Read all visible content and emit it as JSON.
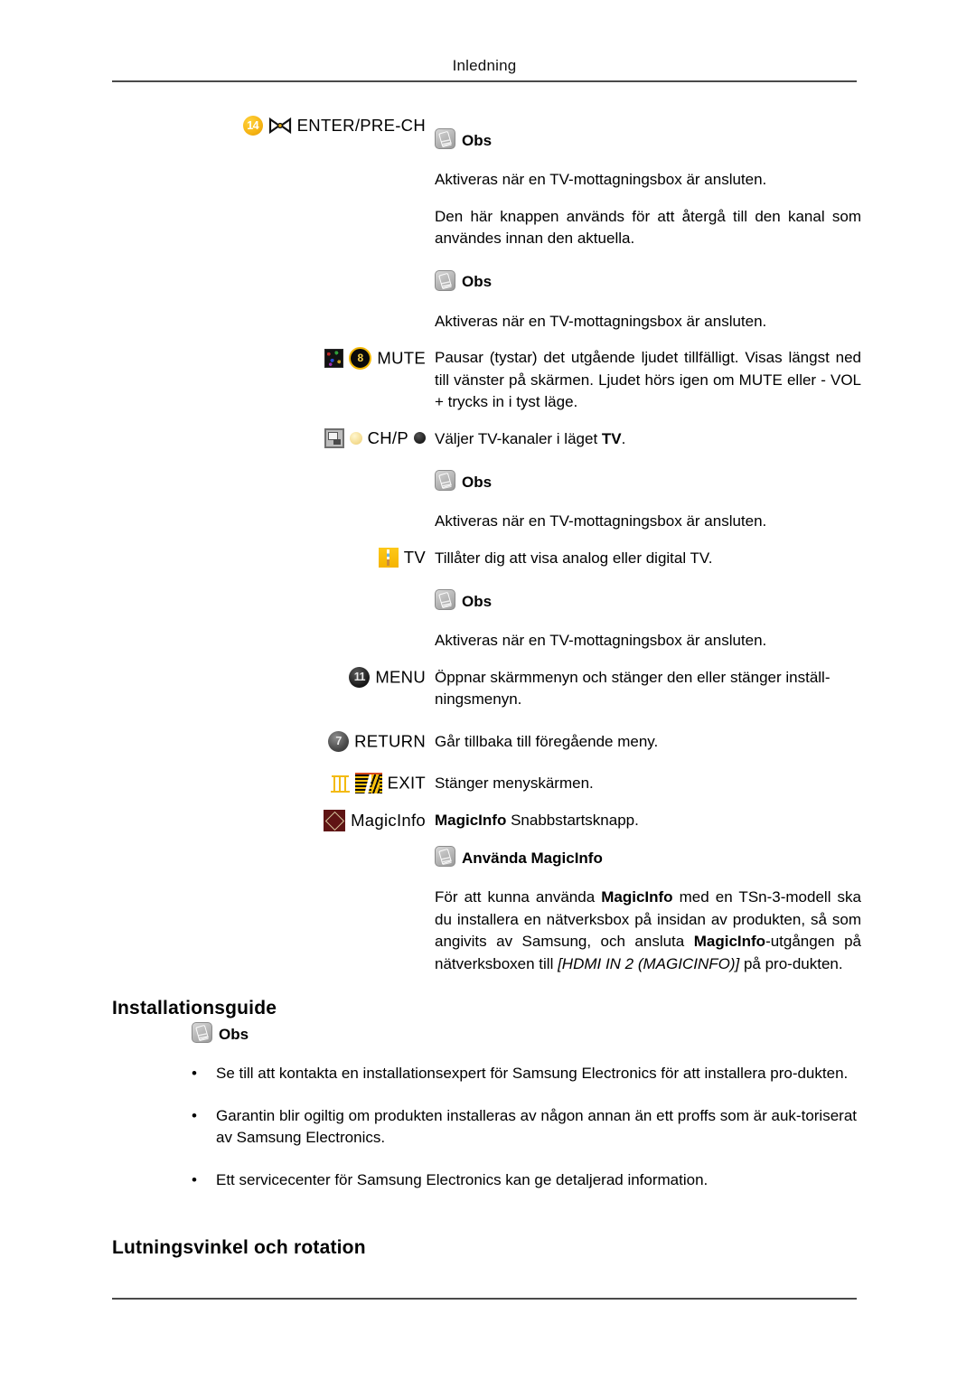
{
  "page": {
    "running_head": "Inledning"
  },
  "button_table": [
    {
      "id": "enter-pre-ch",
      "badge": "14",
      "label": "ENTER/PRE-CH",
      "blocks": [
        {
          "type": "note",
          "text": "Obs"
        },
        {
          "type": "para",
          "text": "Aktiveras när en TV-mottagningsbox är ansluten."
        },
        {
          "type": "para",
          "text": "Den här knappen används för att återgå till den kanal som användes innan den aktuella."
        },
        {
          "type": "note",
          "text": "Obs"
        },
        {
          "type": "para",
          "text": "Aktiveras när en TV-mottagningsbox är ansluten."
        }
      ]
    },
    {
      "id": "mute",
      "badge": "8",
      "label": "MUTE",
      "blocks": [
        {
          "type": "para",
          "text": "Pausar (tystar) det utgående ljudet tillfälligt. Visas längst ned till vänster på skärmen. Ljudet hörs igen om MUTE eller - VOL + trycks in i tyst läge."
        }
      ]
    },
    {
      "id": "ch-p",
      "label": "CH/P",
      "blocks": [
        {
          "type": "para",
          "text": "Väljer TV-kanaler i läget TV."
        },
        {
          "type": "note",
          "text": "Obs"
        },
        {
          "type": "para",
          "text": "Aktiveras när en TV-mottagningsbox är ansluten."
        }
      ]
    },
    {
      "id": "tv",
      "label": "TV",
      "blocks": [
        {
          "type": "para",
          "text": "Tillåter dig att visa analog eller digital TV."
        },
        {
          "type": "note",
          "text": "Obs"
        },
        {
          "type": "para",
          "text": "Aktiveras när en TV-mottagningsbox är ansluten."
        }
      ]
    },
    {
      "id": "menu",
      "badge": "11",
      "label": "MENU",
      "blocks": [
        {
          "type": "para",
          "text": "Öppnar skärmmenyn och stänger den eller stänger inställ-ningsmenyn."
        }
      ]
    },
    {
      "id": "return",
      "badge": "7",
      "label": "RETURN",
      "blocks": [
        {
          "type": "para",
          "text": "Går tillbaka till föregående meny."
        }
      ]
    },
    {
      "id": "exit",
      "label": "EXIT",
      "blocks": [
        {
          "type": "para",
          "text": "Stänger menyskärmen."
        }
      ]
    },
    {
      "id": "magicinfo",
      "label": "MagicInfo",
      "blocks": [
        {
          "type": "para_rich",
          "text": "MagicInfo Snabbstartsknapp."
        },
        {
          "type": "note",
          "text": "Använda MagicInfo"
        },
        {
          "type": "para_rich",
          "text": "För att kunna använda MagicInfo med en TSn-3-modell ska du installera en nätverksbox på insidan av produkten, så som angivits av Samsung, och ansluta MagicInfo-utgången på nätverksboxen till [HDMI IN 2 (MAGICINFO)] på pro-dukten."
        }
      ]
    }
  ],
  "rich": {
    "magicinfo_shortcut": {
      "bold_lead": "MagicInfo",
      "rest": " Snabbstartsknapp."
    },
    "magicinfo_para": {
      "s1": "För att kunna använda ",
      "b1": "MagicInfo",
      "s2": " med en TSn-3-modell ska du installera en nätverksbox på insidan av produkten, så som angivits av Samsung, och ansluta ",
      "b2": "MagicInfo",
      "s3": "-utgången på nätverksboxen till ",
      "i1": "[HDMI IN 2 (MAGICINFO)]",
      "s4": " på pro-dukten."
    },
    "mute_para": {
      "s1": "Pausar (tystar) det utgående ljudet tillfälligt. Visas längst ned till vänster på skärmen. Ljudet hörs igen om MUTE eller - VOL + trycks in i tyst läge."
    },
    "chp_para": {
      "s1": "Väljer TV-kanaler i läget ",
      "b1": "TV",
      "s2": "."
    }
  },
  "installation": {
    "heading": "Installationsguide",
    "note": "Obs",
    "bullet_marker": "•",
    "bullets": [
      "Se till att kontakta en installationsexpert för Samsung Electronics för att installera pro-dukten.",
      "Garantin blir ogiltig om produkten installeras av någon annan än ett proffs som är auk-toriserat av Samsung Electronics.",
      "Ett servicecenter för Samsung Electronics kan ge detaljerad information."
    ]
  },
  "tilt_section": {
    "heading": "Lutningsvinkel och rotation"
  },
  "icons": {
    "note": "note-pen-icon",
    "enter_pre_ch": "bowtie-icon",
    "mute_disc": "mute-disc-icon",
    "noise_square": "noise-thumbnail-icon",
    "gray_square": "monitor-square-icon",
    "pale_dot": "pale-dot-icon",
    "dark_dot": "dark-dot-icon",
    "tv_square": "tv-square-icon",
    "exit_pillar": "pillar-icon",
    "exit_stripes": "striped-book-icon",
    "magicinfo": "magicinfo-diamond-icon"
  },
  "colors": {
    "badge_yellow": "#f6b414",
    "badge_dark": "#1d1d1d",
    "tv_yellow": "#f5b400",
    "magicinfo_maroon": "#5f1414",
    "rule": "#4a4a4a"
  }
}
